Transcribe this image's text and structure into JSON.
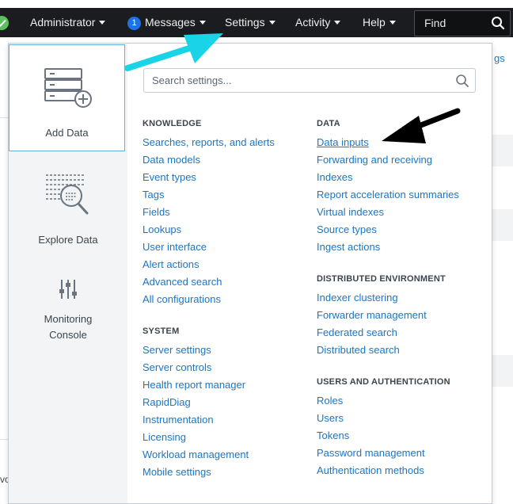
{
  "nav": {
    "administrator": "Administrator",
    "messages_count": "1",
    "messages": "Messages",
    "settings": "Settings",
    "activity": "Activity",
    "help": "Help",
    "find": "Find"
  },
  "background": {
    "partial_link": "gs",
    "partial_text": "vo"
  },
  "sidebar": {
    "items": [
      {
        "label": "Add Data"
      },
      {
        "label": "Explore Data"
      },
      {
        "label_line1": "Monitoring",
        "label_line2": "Console"
      }
    ]
  },
  "search": {
    "placeholder": "Search settings..."
  },
  "knowledge": {
    "title": "KNOWLEDGE",
    "links": [
      "Searches, reports, and alerts",
      "Data models",
      "Event types",
      "Tags",
      "Fields",
      "Lookups",
      "User interface",
      "Alert actions",
      "Advanced search",
      "All configurations"
    ]
  },
  "system": {
    "title": "SYSTEM",
    "links": [
      "Server settings",
      "Server controls",
      "Health report manager",
      "RapidDiag",
      "Instrumentation",
      "Licensing",
      "Workload management",
      "Mobile settings"
    ]
  },
  "data": {
    "title": "DATA",
    "links": [
      "Data inputs",
      "Forwarding and receiving",
      "Indexes",
      "Report acceleration summaries",
      "Virtual indexes",
      "Source types",
      "Ingest actions"
    ]
  },
  "distributed": {
    "title": "DISTRIBUTED ENVIRONMENT",
    "links": [
      "Indexer clustering",
      "Forwarder management",
      "Federated search",
      "Distributed search"
    ]
  },
  "users_auth": {
    "title": "USERS AND AUTHENTICATION",
    "links": [
      "Roles",
      "Users",
      "Tokens",
      "Password management",
      "Authentication methods"
    ]
  },
  "colors": {
    "nav_bg": "#1a1c20",
    "link": "#1a76c8",
    "annotation_cyan": "#19d3e6",
    "annotation_black": "#000000"
  },
  "icons": [
    "check-status-icon",
    "search-icon",
    "add-data-server-icon",
    "explore-data-icon",
    "monitoring-sliders-icon"
  ]
}
